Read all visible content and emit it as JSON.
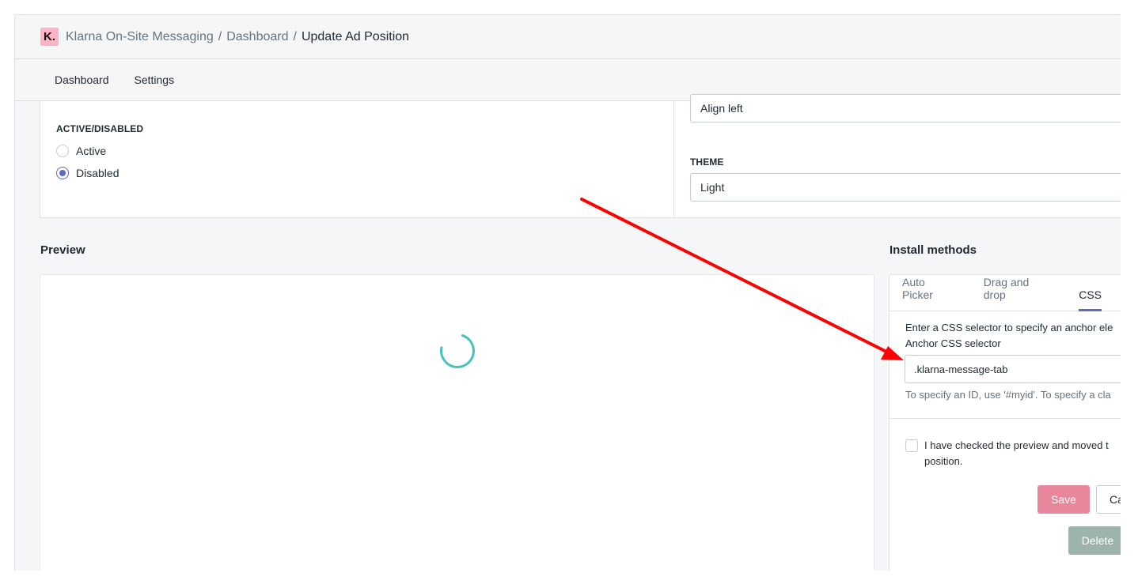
{
  "header": {
    "logo_text": "K.",
    "breadcrumb": [
      "Klarna On-Site Messaging",
      "Dashboard"
    ],
    "current": "Update Ad Position",
    "separator": "/",
    "logo_color": "#ffb3c7"
  },
  "nav": {
    "items": [
      "Dashboard",
      "Settings"
    ]
  },
  "settings": {
    "status_label": "ACTIVE/DISABLED",
    "options": [
      "Active",
      "Disabled"
    ],
    "selected": "Disabled",
    "alignment_value": "Align left",
    "theme_label": "THEME",
    "theme_value": "Light"
  },
  "preview": {
    "title": "Preview",
    "spinner_color": "#47c1bf"
  },
  "install": {
    "title": "Install methods",
    "tabs": [
      "Auto Picker",
      "Drag and drop",
      "CSS"
    ],
    "active_tab": "CSS",
    "help_text": "Enter a CSS selector to specify an anchor ele",
    "field_label": "Anchor CSS selector",
    "field_value": ".klarna-message-tab",
    "hint": "To specify an ID, use '#myid'. To specify a cla",
    "checkbox_text": "I have checked the preview and moved t position.",
    "save_label": "Save",
    "cancel_label": "Ca",
    "delete_label": "Delete",
    "accent_color": "#5c6ac4",
    "save_color": "#e8879c",
    "delete_color": "#9db4aa"
  },
  "annotation": {
    "arrow_color": "#ff0000"
  }
}
